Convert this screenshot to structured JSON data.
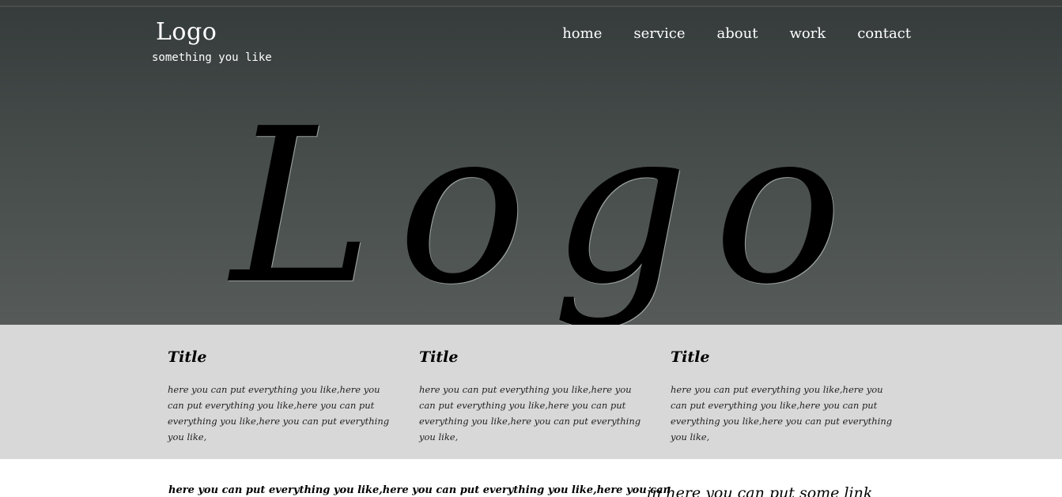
{
  "header": {
    "brand_title": "Logo",
    "brand_tagline": "something you like",
    "nav": [
      "home",
      "service",
      "about",
      "work",
      "contact"
    ]
  },
  "hero": {
    "logo_text": "Logo"
  },
  "features": [
    {
      "title": "Title",
      "body": "here you can put everything you like,here you can put everything you like,here you can put everything you like,here you can put everything you like,"
    },
    {
      "title": "Title",
      "body": "here you can put everything you like,here you can put everything you like,here you can put everything you like,here you can put everything you like,"
    },
    {
      "title": "Title",
      "body": "here you can put everything you like,here you can put everything you like,here you can put everything you like,here you can put everything you like,"
    }
  ],
  "footer": {
    "text": "here you can put everything you like,here you can put everything you like,here you can",
    "link": "in here you can put some link"
  },
  "colors": {
    "hero_top": "#353c3b",
    "hero_bottom": "#565b59",
    "features_bg": "#d8d8d8",
    "text_light": "#ffffff",
    "text_dark": "#000000"
  }
}
